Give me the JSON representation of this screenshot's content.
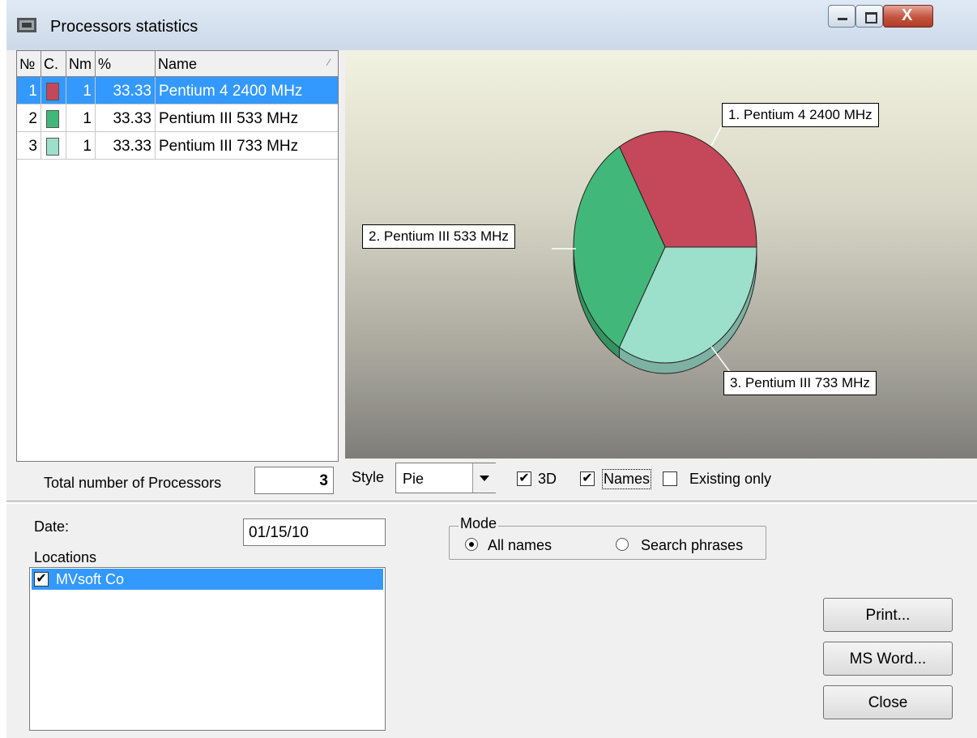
{
  "window": {
    "title": "Processors statistics"
  },
  "grid": {
    "columns": [
      "№",
      "C.",
      "Nm",
      "%",
      "Name"
    ],
    "rows": [
      {
        "no": "1",
        "color": "#c5475a",
        "nm": "1",
        "pct": "33.33",
        "name": "Pentium 4 2400 MHz",
        "selected": true
      },
      {
        "no": "2",
        "color": "#41b879",
        "nm": "1",
        "pct": "33.33",
        "name": "Pentium III 533 MHz",
        "selected": false
      },
      {
        "no": "3",
        "color": "#9cdfcb",
        "nm": "1",
        "pct": "33.33",
        "name": "Pentium III 733 MHz",
        "selected": false
      }
    ],
    "total_label": "Total number of Processors",
    "total_value": "3"
  },
  "chart_data": {
    "type": "pie",
    "categories": [
      "1. Pentium 4 2400 MHz",
      "2. Pentium III 533 MHz",
      "3. Pentium III 733 MHz"
    ],
    "values": [
      33.33,
      33.33,
      33.33
    ],
    "colors": [
      "#c5475a",
      "#41b879",
      "#9cdfcb"
    ],
    "style_3d": true
  },
  "chart_controls": {
    "style_label": "Style",
    "style_value": "Pie",
    "opt_3d": {
      "label": "3D",
      "checked": true
    },
    "opt_names": {
      "label": "Names",
      "checked": true
    },
    "opt_existing": {
      "label": "Existing only",
      "checked": false
    }
  },
  "filters": {
    "date_label": "Date:",
    "date_value": "01/15/10",
    "locations_label": "Locations",
    "locations": [
      {
        "label": "MVsoft Co",
        "checked": true,
        "selected": true
      }
    ],
    "mode_label": "Mode",
    "mode_options": [
      {
        "label": "All names",
        "selected": true
      },
      {
        "label": "Search phrases",
        "selected": false
      }
    ]
  },
  "buttons": {
    "print": "Print...",
    "word": "MS Word...",
    "close": "Close"
  }
}
